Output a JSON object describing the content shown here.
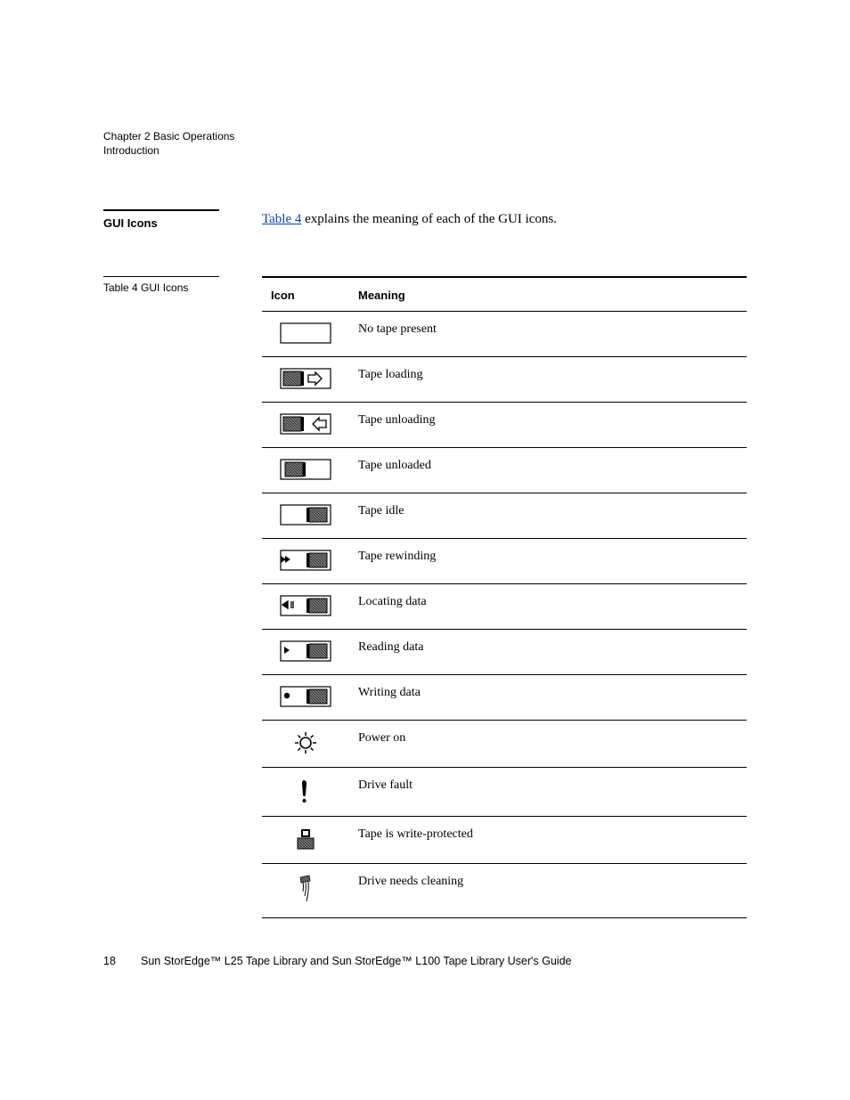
{
  "header": {
    "chapter": "Chapter 2  Basic Operations",
    "section": "Introduction"
  },
  "side_heading": "GUI Icons",
  "intro": {
    "link": "Table 4",
    "rest": " explains the meaning of each of the GUI icons."
  },
  "table": {
    "caption": "Table 4   GUI Icons",
    "head_icon": "Icon",
    "head_meaning": "Meaning",
    "rows": [
      {
        "icon": "no-tape",
        "meaning": "No tape present"
      },
      {
        "icon": "tape-loading",
        "meaning": "Tape loading"
      },
      {
        "icon": "tape-unloading",
        "meaning": "Tape unloading"
      },
      {
        "icon": "tape-unloaded",
        "meaning": "Tape unloaded"
      },
      {
        "icon": "tape-idle",
        "meaning": "Tape idle"
      },
      {
        "icon": "tape-rewinding",
        "meaning": "Tape rewinding"
      },
      {
        "icon": "locating-data",
        "meaning": "Locating data"
      },
      {
        "icon": "reading-data",
        "meaning": "Reading data"
      },
      {
        "icon": "writing-data",
        "meaning": "Writing data"
      },
      {
        "icon": "power-on",
        "meaning": "Power on"
      },
      {
        "icon": "drive-fault",
        "meaning": "Drive fault"
      },
      {
        "icon": "write-protected",
        "meaning": "Tape is write-protected"
      },
      {
        "icon": "needs-cleaning",
        "meaning": "Drive needs cleaning"
      }
    ]
  },
  "footer": {
    "page": "18",
    "title": "Sun StorEdge™ L25 Tape Library and Sun StorEdge™ L100 Tape Library User's Guide"
  }
}
